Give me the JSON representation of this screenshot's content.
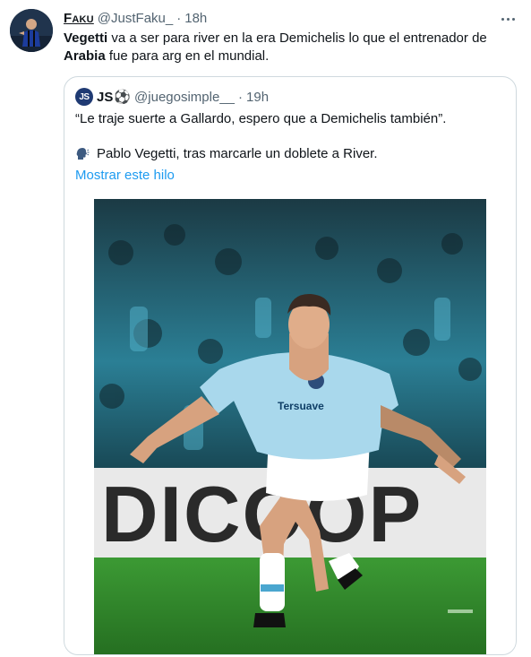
{
  "tweet": {
    "display_name": "Faku",
    "handle": "@JustFaku_",
    "separator": "·",
    "time": "18h",
    "text": {
      "part1_bold": "Vegetti",
      "part2": " va a ser para river en la era Demichelis lo que el entrenador de ",
      "part3_bold": "Arabia",
      "part4": " fue para arg en el mundial."
    }
  },
  "quoted": {
    "avatar_text": "JS",
    "display_name": "JS",
    "ball_icon": "⚽",
    "handle": "@juegosimple__",
    "separator": "·",
    "time": "19h",
    "line1": "“Le traje suerte a Gallardo, espero que a Demichelis también”.",
    "speaker_icon": "speaking-head-icon",
    "line2": "Pablo Vegetti, tras marcarle un doblete a River.",
    "show_thread": "Mostrar este hilo",
    "photo": {
      "banner_text": "DICOOP",
      "shirt_sponsor": "Tersuave"
    }
  },
  "colors": {
    "link": "#1d9bf0",
    "secondary": "#536471",
    "border": "#cfd9de",
    "pitch": "#2f8a2c",
    "shirt": "#a9d8ec"
  }
}
